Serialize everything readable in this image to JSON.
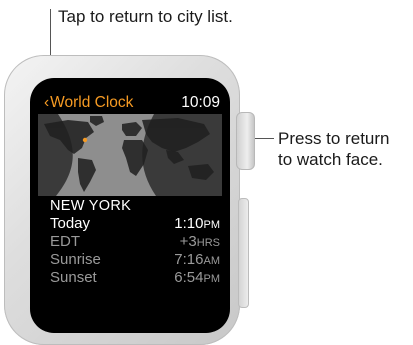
{
  "callouts": {
    "top": "Tap to return to city list.",
    "right_line1": "Press to return",
    "right_line2": "to watch face."
  },
  "watch": {
    "status_bar": {
      "back_chevron": "‹",
      "title": "World Clock",
      "time": "10:09"
    },
    "city": {
      "name": "NEW YORK",
      "rows": [
        {
          "label": "Today",
          "value": "1:10",
          "unit": "PM"
        },
        {
          "label": "EDT",
          "value": "+3",
          "unit": "HRS"
        },
        {
          "label": "Sunrise",
          "value": "7:16",
          "unit": "AM"
        },
        {
          "label": "Sunset",
          "value": "6:54",
          "unit": "PM"
        }
      ]
    },
    "map": {
      "icon": "world-map-daylight",
      "marker_color": "#f59a23"
    }
  },
  "colors": {
    "accent": "#f59a23",
    "screen_bg": "#000000",
    "dim_text": "#9a9a9a"
  }
}
